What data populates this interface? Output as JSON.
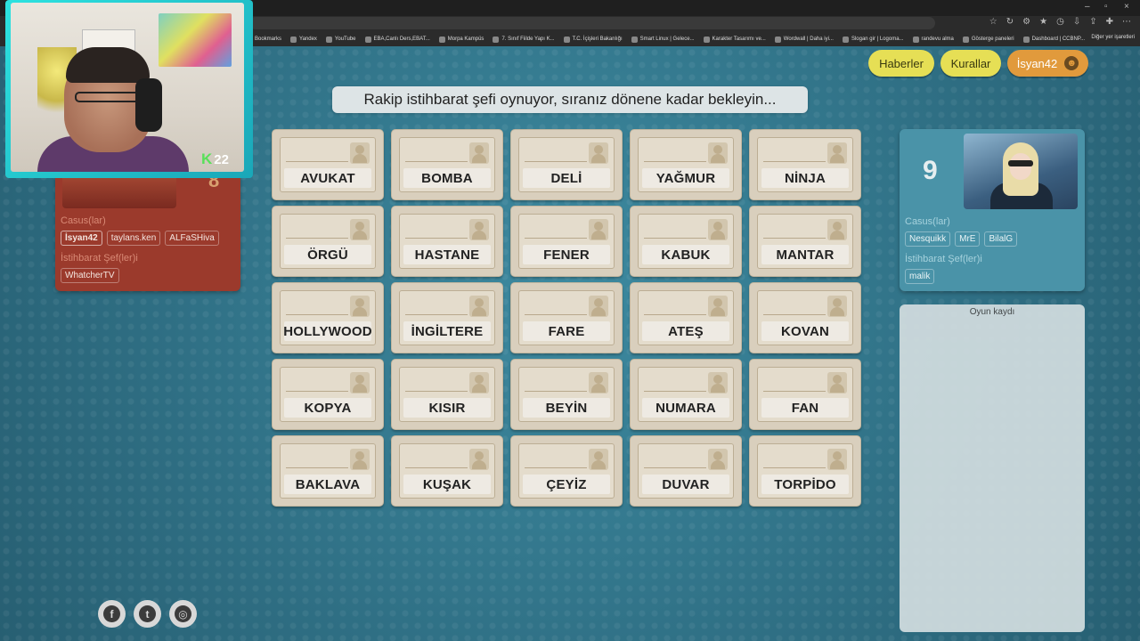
{
  "browser": {
    "bookmarks": [
      "Bookmarks",
      "Yandex",
      "YouTube",
      "EBA,Canlı Ders,EBAT...",
      "Morpa Kampüs",
      "7. Sınıf Fiilde Yapı K...",
      "T.C. İçişleri Bakanlığı",
      "Smart Linux | Gelece...",
      "Karakter Tasarımı ve...",
      "Wordwall | Daha iyi...",
      "Slogan gir | Logoma...",
      "randevu alma",
      "Gösterge paneleri",
      "Dashboard | CCBNP..."
    ],
    "bookmarks_other": "Diğer yer işaretleri"
  },
  "header": {
    "news_label": "Haberler",
    "rules_label": "Kurallar",
    "user_label": "İsyan42",
    "user_icon": "smiley-icon"
  },
  "status_message": "Rakip istihbarat şefi oynuyor, sıranız dönene kadar bekleyin...",
  "cards": [
    "AVUKAT",
    "BOMBA",
    "DELİ",
    "YAĞMUR",
    "NİNJA",
    "ÖRGÜ",
    "HASTANE",
    "FENER",
    "KABUK",
    "MANTAR",
    "HOLLYWOOD",
    "İNGİLTERE",
    "FARE",
    "ATEŞ",
    "KOVAN",
    "KOPYA",
    "KISIR",
    "BEYİN",
    "NUMARA",
    "FAN",
    "BAKLAVA",
    "KUŞAK",
    "ÇEYİZ",
    "DUVAR",
    "TORPİDO"
  ],
  "red_team": {
    "color": "#9b3a2c",
    "spies_label": "Casus(lar)",
    "spies": [
      "İsyan42",
      "taylans.ken",
      "ALFaSHiva"
    ],
    "chiefs_label": "İstihbarat Şef(ler)i",
    "chiefs": [
      "WhatcherTV"
    ]
  },
  "blue_team": {
    "color": "#4a93a8",
    "count": "9",
    "spies_label": "Casus(lar)",
    "spies": [
      "Nesquikk",
      "MrE",
      "BilalG"
    ],
    "chiefs_label": "İstihbarat Şef(ler)i",
    "chiefs": [
      "malik"
    ]
  },
  "game_log": {
    "title": "Oyun kaydı"
  },
  "social": [
    "facebook-icon",
    "twitter-icon",
    "instagram-icon"
  ],
  "webcam": {
    "badge_k": "K",
    "badge_count": "22"
  }
}
